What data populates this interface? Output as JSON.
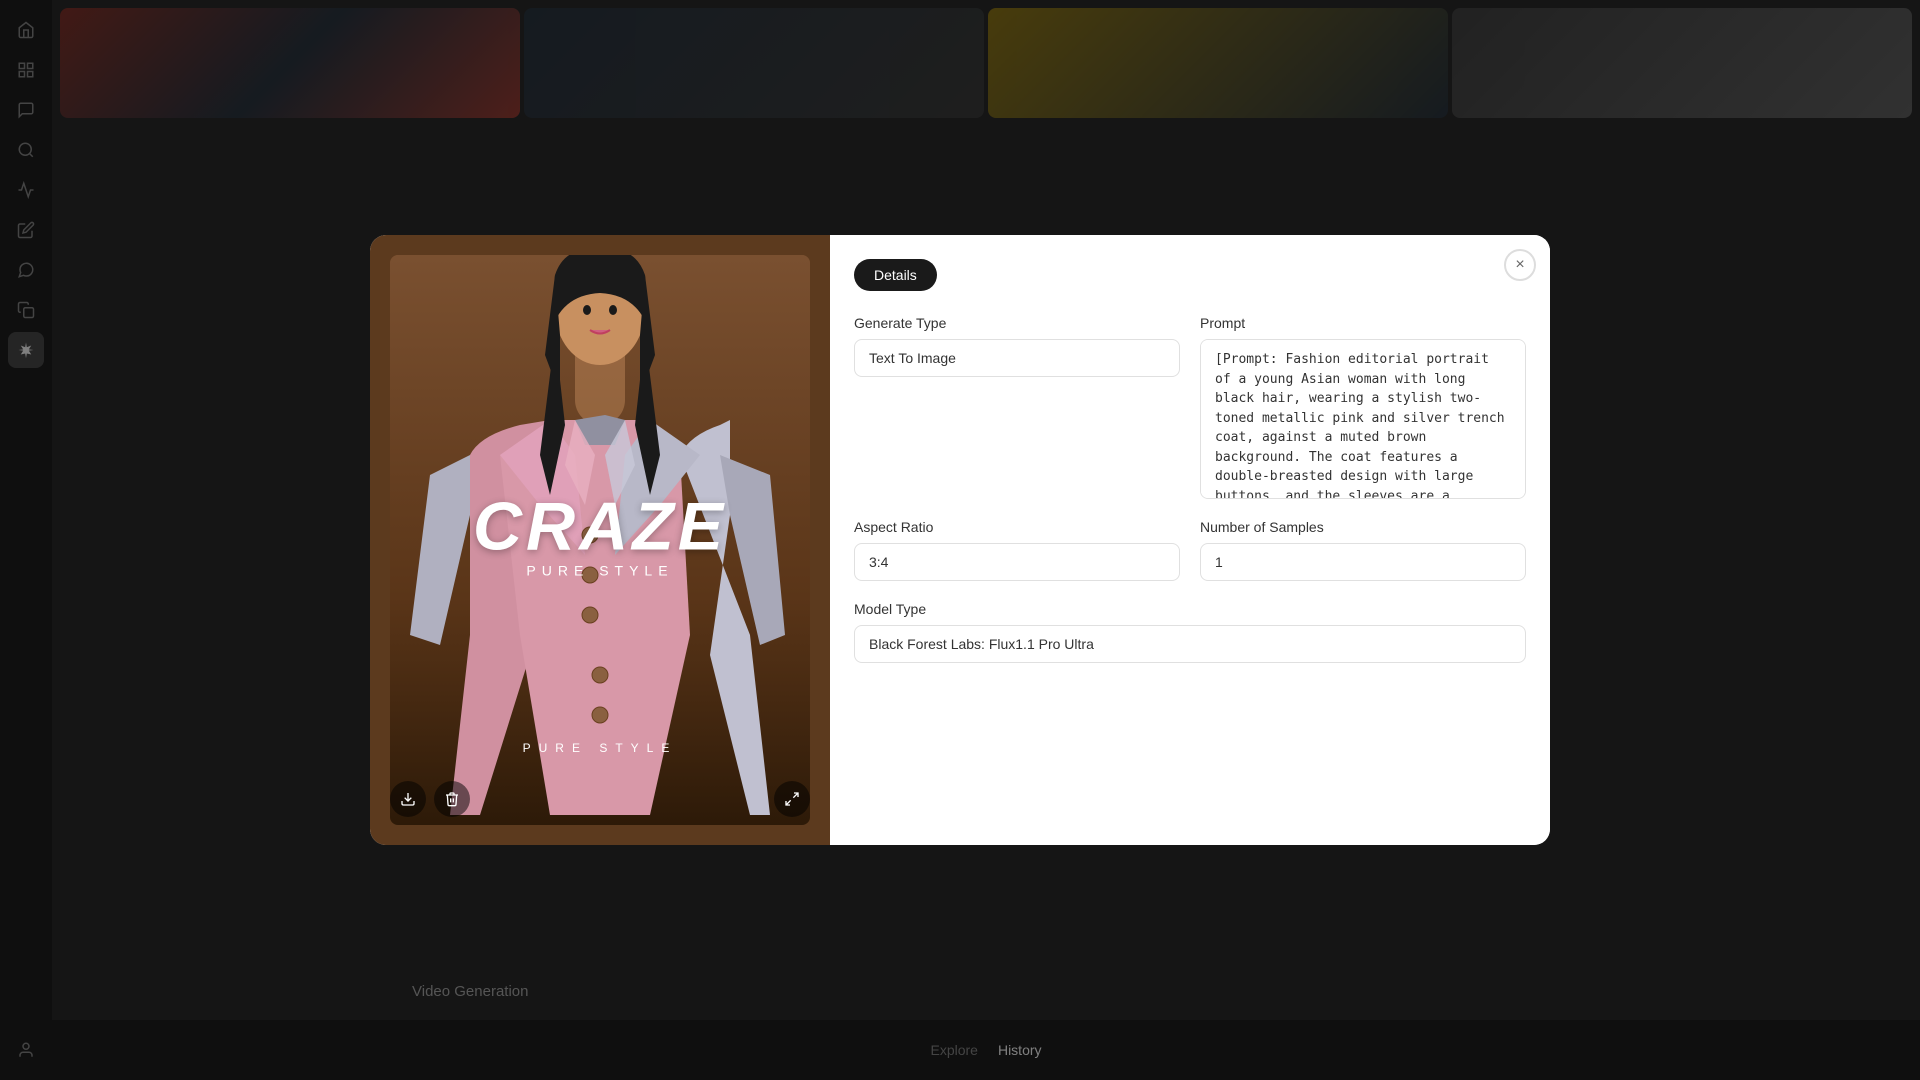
{
  "sidebar": {
    "icons": [
      {
        "name": "home-icon",
        "symbol": "⌂",
        "active": false
      },
      {
        "name": "message-icon",
        "symbol": "▭",
        "active": false
      },
      {
        "name": "chat-icon",
        "symbol": "💬",
        "active": false
      },
      {
        "name": "search-icon",
        "symbol": "🔍",
        "active": false
      },
      {
        "name": "chart-icon",
        "symbol": "📊",
        "active": false
      },
      {
        "name": "edit-icon",
        "symbol": "✏️",
        "active": false
      },
      {
        "name": "comment-icon",
        "symbol": "💬",
        "active": false
      },
      {
        "name": "copy-icon",
        "symbol": "⧉",
        "active": false
      },
      {
        "name": "ai-icon",
        "symbol": "✦",
        "active": true
      },
      {
        "name": "user-icon",
        "symbol": "👤",
        "active": false
      }
    ],
    "bottom_icons": [
      {
        "name": "help-icon",
        "symbol": "?"
      },
      {
        "name": "settings-icon",
        "symbol": "↑"
      }
    ]
  },
  "background": {
    "images": [
      "img1",
      "img2",
      "img3",
      "img4"
    ]
  },
  "bottom_nav": {
    "video_label": "Video Generation",
    "links": [
      {
        "label": "Explore",
        "active": false
      },
      {
        "label": "History",
        "active": true
      }
    ]
  },
  "modal": {
    "close_label": "×",
    "tab_label": "Details",
    "generate_type": {
      "label": "Generate Type",
      "value": "Text To Image"
    },
    "prompt": {
      "label": "Prompt",
      "value": "[Prompt: Fashion editorial portrait of a young Asian woman with long black hair, wearing a stylish two-toned metallic pink and silver trench coat, against a muted brown background. The coat features a double-breasted design with large buttons, and the sleeves are a slightly darker shade of silver. The model is wearing a gray satin camisole underneath,"
    },
    "aspect_ratio": {
      "label": "Aspect Ratio",
      "value": "3:4"
    },
    "number_of_samples": {
      "label": "Number of Samples",
      "value": "1"
    },
    "model_type": {
      "label": "Model Type",
      "value": "Black Forest Labs: Flux1.1 Pro Ultra"
    },
    "image": {
      "title": "CRAZE",
      "subtitle": "PURE STYLE",
      "bottom_text": "PURE STYLE"
    },
    "actions": {
      "download_label": "⬇",
      "delete_label": "🗑",
      "expand_label": "⤢"
    }
  }
}
